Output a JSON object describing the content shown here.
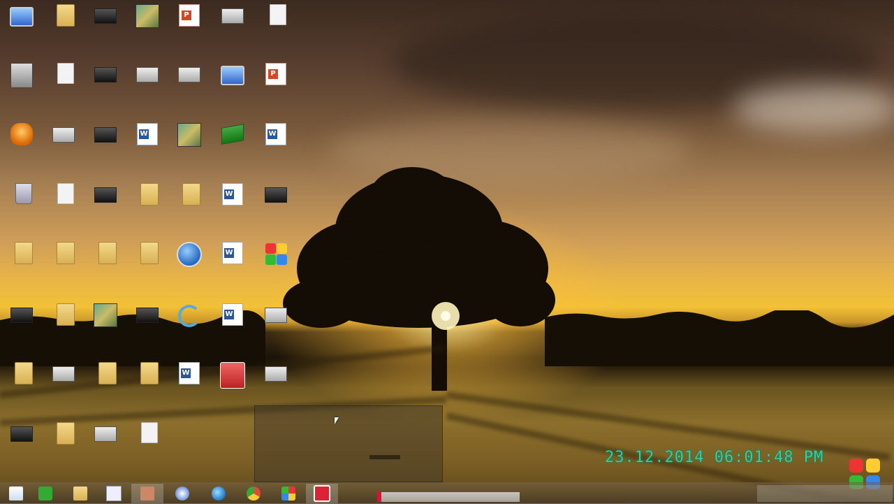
{
  "desktop": {
    "icons": [
      {
        "label": "",
        "glyph": "monitor-icon"
      },
      {
        "label": "",
        "glyph": "folder-icon"
      },
      {
        "label": "",
        "glyph": "dark-image-icon"
      },
      {
        "label": "",
        "glyph": "photo-icon"
      },
      {
        "label": "",
        "glyph": "powerpoint-icon"
      },
      {
        "label": "",
        "glyph": "image-thumb-icon"
      },
      {
        "label": "",
        "glyph": "document-icon"
      },
      {
        "label": "",
        "glyph": "person-photo-icon"
      },
      {
        "label": "",
        "glyph": "document-icon"
      },
      {
        "label": "",
        "glyph": "dark-image-icon"
      },
      {
        "label": "",
        "glyph": "image-thumb-icon"
      },
      {
        "label": "",
        "glyph": "image-thumb-icon"
      },
      {
        "label": "",
        "glyph": "monitor-icon"
      },
      {
        "label": "",
        "glyph": "powerpoint-icon"
      },
      {
        "label": "",
        "glyph": "orange-app-icon"
      },
      {
        "label": "",
        "glyph": "image-thumb-icon"
      },
      {
        "label": "",
        "glyph": "dark-image-icon"
      },
      {
        "label": "",
        "glyph": "word-icon"
      },
      {
        "label": "",
        "glyph": "photo-icon"
      },
      {
        "label": "",
        "glyph": "books-icon"
      },
      {
        "label": "",
        "glyph": "word-icon"
      },
      {
        "label": "",
        "glyph": "recycle-bin-icon"
      },
      {
        "label": "",
        "glyph": "document-icon"
      },
      {
        "label": "",
        "glyph": "dark-image-icon"
      },
      {
        "label": "",
        "glyph": "folder-icon"
      },
      {
        "label": "",
        "glyph": "folder-icon"
      },
      {
        "label": "",
        "glyph": "word-icon"
      },
      {
        "label": "",
        "glyph": "dark-image-icon"
      },
      {
        "label": "",
        "glyph": "folder-icon"
      },
      {
        "label": "",
        "glyph": "folder-icon"
      },
      {
        "label": "",
        "glyph": "folder-icon"
      },
      {
        "label": "",
        "glyph": "folder-icon"
      },
      {
        "label": "",
        "glyph": "globe-icon"
      },
      {
        "label": "",
        "glyph": "word-icon"
      },
      {
        "label": "",
        "glyph": "tiles-icon"
      },
      {
        "label": "",
        "glyph": "dark-image-icon"
      },
      {
        "label": "",
        "glyph": "folder-icon"
      },
      {
        "label": "",
        "glyph": "photo-icon"
      },
      {
        "label": "",
        "glyph": "dark-image-icon"
      },
      {
        "label": "",
        "glyph": "sync-icon"
      },
      {
        "label": "",
        "glyph": "word-icon"
      },
      {
        "label": "",
        "glyph": "image-thumb-icon"
      },
      {
        "label": "",
        "glyph": "folder-icon"
      },
      {
        "label": "",
        "glyph": "image-thumb-icon"
      },
      {
        "label": "",
        "glyph": "folder-icon"
      },
      {
        "label": "",
        "glyph": "folder-icon"
      },
      {
        "label": "",
        "glyph": "word-icon"
      },
      {
        "label": "",
        "glyph": "red-app-icon"
      },
      {
        "label": "",
        "glyph": "image-thumb-icon"
      },
      {
        "label": "",
        "glyph": "dark-image-icon"
      },
      {
        "label": "",
        "glyph": "folder-icon"
      },
      {
        "label": "",
        "glyph": "image-thumb-icon"
      },
      {
        "label": "",
        "glyph": "document-icon"
      }
    ]
  },
  "clock": {
    "text": "23.12.2014 06:01:48 PM"
  },
  "taskbar": {
    "buttons": [
      {
        "name": "start-button",
        "glyph": "windows-icon"
      },
      {
        "name": "task-app-1",
        "glyph": "green-app-icon"
      },
      {
        "name": "task-explorer",
        "glyph": "folder-icon"
      },
      {
        "name": "task-notepad",
        "glyph": "document-icon"
      },
      {
        "name": "task-app-active",
        "glyph": "app-icon"
      },
      {
        "name": "task-app-blue",
        "glyph": "blue-app-icon"
      },
      {
        "name": "task-ie",
        "glyph": "internet-explorer-icon"
      },
      {
        "name": "task-chrome",
        "glyph": "chrome-icon"
      },
      {
        "name": "task-tiles",
        "glyph": "tiles-icon"
      },
      {
        "name": "task-red-app",
        "glyph": "red-app-icon"
      }
    ]
  },
  "colors": {
    "clock": "#2fd6c5",
    "sky_glow": "#f2c136",
    "chrome_red": "#dd4b39"
  }
}
